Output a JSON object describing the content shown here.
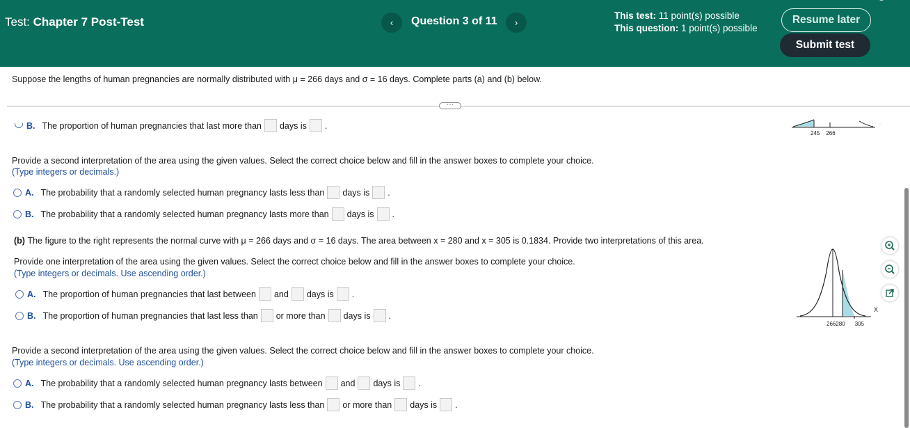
{
  "header": {
    "test_prefix": "Test:",
    "test_name": "Chapter 7 Post-Test",
    "question_label": "Question 3 of 11",
    "prev_icon": "chevron-left-icon",
    "next_icon": "chevron-right-icon",
    "test_points_label": "This test:",
    "test_points_value": "11 point(s) possible",
    "question_points_label": "This question:",
    "question_points_value": "1 point(s) possible",
    "resume_label": "Resume later",
    "submit_label": "Submit test",
    "colors": {
      "bar": "#0a6e5c",
      "submit": "#1f2a33"
    }
  },
  "problem": "Suppose the lengths of human pregnancies are normally distributed with μ = 266 days and σ = 16 days. Complete parts (a) and (b) below.",
  "part_a_tail": {
    "option_b": {
      "letter": "B.",
      "t1": "The proportion of human pregnancies that last more than",
      "t2": "days is",
      "t3": "."
    }
  },
  "second_a": {
    "prompt": "Provide a second interpretation of the area using the given values. Select the correct choice below and fill in the answer boxes to complete your choice.",
    "hint": "(Type integers or decimals.)",
    "option_a": {
      "letter": "A.",
      "t1": "The probability that a randomly selected human pregnancy lasts less than",
      "t2": "days is",
      "t3": "."
    },
    "option_b": {
      "letter": "B.",
      "t1": "The probability that a randomly selected human pregnancy lasts more than",
      "t2": "days is",
      "t3": "."
    }
  },
  "part_b": {
    "label": "(b)",
    "statement": "The figure to the right represents the normal curve with μ = 266 days and σ = 16 days. The area between x = 280 and x = 305 is 0.1834. Provide two interpretations of this area.",
    "prompt": "Provide one interpretation of the area using the given values. Select the correct choice below and fill in the answer boxes to complete your choice.",
    "hint": "(Type integers or decimals. Use ascending order.)",
    "option_a": {
      "letter": "A.",
      "t1": "The proportion of human pregnancies that last between",
      "t2": "and",
      "t3": "days is",
      "t4": "."
    },
    "option_b": {
      "letter": "B.",
      "t1": "The proportion of human pregnancies that last less than",
      "t2": "or more than",
      "t3": "days is",
      "t4": "."
    }
  },
  "second_b": {
    "prompt": "Provide a second interpretation of the area using the given values. Select the correct choice below and fill in the answer boxes to complete your choice.",
    "hint": "(Type integers or decimals. Use ascending order.)",
    "option_a": {
      "letter": "A.",
      "t1": "The probability that a randomly selected human pregnancy lasts between",
      "t2": "and",
      "t3": "days is",
      "t4": "."
    },
    "option_b": {
      "letter": "B.",
      "t1": "The probability that a randomly selected human pregnancy lasts less than",
      "t2": "or more than",
      "t3": "days is",
      "t4": "."
    }
  },
  "figure_a": {
    "ticks": [
      "245",
      "266"
    ]
  },
  "figure_b": {
    "ticks": [
      "266",
      "280",
      "305"
    ],
    "x_label": "X",
    "shade_color": "#a9dde6"
  },
  "tools": [
    "zoom-in-icon",
    "zoom-out-icon",
    "popout-icon"
  ]
}
